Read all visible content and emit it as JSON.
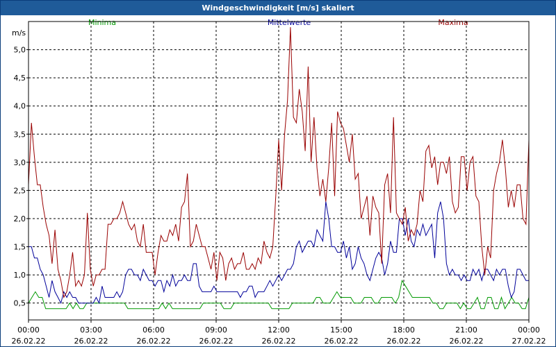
{
  "window": {
    "title": "Windgeschwindigkeit [m/s] skaliert"
  },
  "colors": {
    "minima": "#009900",
    "mittelwerte": "#000099",
    "maxima": "#990000",
    "title_bar": "#1f5b99",
    "grid": "#000000"
  },
  "chart_data": {
    "type": "line",
    "title": "Windgeschwindigkeit [m/s] skaliert",
    "ylabel": "m/s",
    "xlabel": "",
    "ylim": [
      0.2,
      5.5
    ],
    "y_ticks": [
      {
        "value": 0.5,
        "label": "0,5"
      },
      {
        "value": 1.0,
        "label": "1,0"
      },
      {
        "value": 1.5,
        "label": "1,5"
      },
      {
        "value": 2.0,
        "label": "2,0"
      },
      {
        "value": 2.5,
        "label": "2,5"
      },
      {
        "value": 3.0,
        "label": "3,0"
      },
      {
        "value": 3.5,
        "label": "3,5"
      },
      {
        "value": 4.0,
        "label": "4,0"
      },
      {
        "value": 4.5,
        "label": "4,5"
      },
      {
        "value": 5.0,
        "label": "5,0"
      }
    ],
    "x_range": [
      "26.02.22 00:00",
      "27.02.22 00:00"
    ],
    "x_ticks": [
      {
        "time": "00:00",
        "date": "26.02.22"
      },
      {
        "time": "03:00",
        "date": "26.02.22"
      },
      {
        "time": "06:00",
        "date": "26.02.22"
      },
      {
        "time": "09:00",
        "date": "26.02.22"
      },
      {
        "time": "12:00",
        "date": "26.02.22"
      },
      {
        "time": "15:00",
        "date": "26.02.22"
      },
      {
        "time": "18:00",
        "date": "26.02.22"
      },
      {
        "time": "21:00",
        "date": "26.02.22"
      },
      {
        "time": "00:00",
        "date": "27.02.22"
      }
    ],
    "grid": true,
    "legend_position": "top",
    "x": [
      "00:00",
      "00:10",
      "00:20",
      "00:30",
      "00:40",
      "00:50",
      "01:00",
      "01:10",
      "01:20",
      "01:30",
      "01:40",
      "01:50",
      "02:00",
      "02:10",
      "02:20",
      "02:30",
      "02:40",
      "02:50",
      "03:00",
      "03:10",
      "03:20",
      "03:30",
      "03:40",
      "03:50",
      "04:00",
      "04:10",
      "04:20",
      "04:30",
      "04:40",
      "04:50",
      "05:00",
      "05:10",
      "05:20",
      "05:30",
      "05:40",
      "05:50",
      "06:00",
      "06:10",
      "06:20",
      "06:30",
      "06:40",
      "06:50",
      "07:00",
      "07:10",
      "07:20",
      "07:30",
      "07:40",
      "07:50",
      "08:00",
      "08:10",
      "08:20",
      "08:30",
      "08:40",
      "08:50",
      "09:00",
      "09:10",
      "09:20",
      "09:30",
      "09:40",
      "09:50",
      "10:00",
      "10:10",
      "10:20",
      "10:30",
      "10:40",
      "10:50",
      "11:00",
      "11:10",
      "11:20",
      "11:30",
      "11:40",
      "11:50",
      "12:00",
      "12:10",
      "12:20",
      "12:30",
      "12:40",
      "12:50",
      "13:00",
      "13:10",
      "13:20",
      "13:30",
      "13:40",
      "13:50",
      "14:00",
      "14:10",
      "14:20",
      "14:30",
      "14:40",
      "14:50",
      "15:00",
      "15:10",
      "15:20",
      "15:30",
      "15:40",
      "15:50",
      "16:00",
      "16:10",
      "16:20",
      "16:30",
      "16:40",
      "16:50",
      "17:00",
      "17:10",
      "17:20",
      "17:30",
      "17:40",
      "17:50",
      "18:00",
      "18:10",
      "18:20",
      "18:30",
      "18:40",
      "18:50",
      "19:00",
      "19:10",
      "19:20",
      "19:30",
      "19:40",
      "19:50",
      "20:00",
      "20:10",
      "20:20",
      "20:30",
      "20:40",
      "20:50",
      "21:00",
      "21:10",
      "21:20",
      "21:30",
      "21:40",
      "21:50",
      "22:00",
      "22:10",
      "22:20",
      "22:30",
      "22:40",
      "22:50",
      "23:00",
      "23:10",
      "23:20",
      "23:30",
      "23:40",
      "23:50",
      "00:00"
    ],
    "series": [
      {
        "name": "Minima",
        "color": "#009900",
        "values": [
          0.5,
          0.6,
          0.7,
          0.6,
          0.6,
          0.4,
          0.4,
          0.4,
          0.4,
          0.4,
          0.4,
          0.4,
          0.5,
          0.4,
          0.5,
          0.4,
          0.4,
          0.5,
          0.5,
          0.5,
          0.5,
          0.5,
          0.5,
          0.5,
          0.5,
          0.5,
          0.5,
          0.5,
          0.5,
          0.4,
          0.4,
          0.4,
          0.4,
          0.4,
          0.4,
          0.4,
          0.4,
          0.4,
          0.4,
          0.5,
          0.4,
          0.5,
          0.4,
          0.4,
          0.4,
          0.4,
          0.4,
          0.4,
          0.4,
          0.4,
          0.4,
          0.5,
          0.5,
          0.5,
          0.5,
          0.5,
          0.5,
          0.4,
          0.4,
          0.4,
          0.5,
          0.5,
          0.5,
          0.5,
          0.5,
          0.5,
          0.5,
          0.5,
          0.5,
          0.5,
          0.5,
          0.4,
          0.4,
          0.4,
          0.4,
          0.4,
          0.4,
          0.5,
          0.5,
          0.5,
          0.5,
          0.5,
          0.5,
          0.5,
          0.6,
          0.6,
          0.5,
          0.5,
          0.5,
          0.6,
          0.7,
          0.6,
          0.6,
          0.6,
          0.6,
          0.5,
          0.5,
          0.5,
          0.6,
          0.6,
          0.6,
          0.5,
          0.5,
          0.6,
          0.6,
          0.6,
          0.6,
          0.5,
          0.6,
          0.9,
          0.8,
          0.7,
          0.6,
          0.6,
          0.6,
          0.6,
          0.6,
          0.6,
          0.5,
          0.5,
          0.4,
          0.4,
          0.5,
          0.5,
          0.5,
          0.5,
          0.4,
          0.5,
          0.4,
          0.4,
          0.5,
          0.6,
          0.4,
          0.4,
          0.6,
          0.6,
          0.4,
          0.4,
          0.6,
          0.4,
          0.5,
          0.6,
          0.5,
          0.5,
          0.4,
          0.4,
          0.6
        ]
      },
      {
        "name": "Mittelwerte",
        "color": "#000099",
        "values": [
          1.5,
          1.5,
          1.3,
          1.3,
          1.1,
          1.0,
          0.8,
          0.6,
          0.9,
          0.7,
          0.6,
          0.5,
          0.7,
          0.6,
          0.7,
          0.6,
          0.6,
          0.5,
          0.5,
          0.5,
          0.5,
          0.5,
          0.5,
          0.6,
          0.5,
          0.8,
          0.6,
          0.6,
          0.6,
          0.6,
          0.7,
          0.6,
          0.7,
          1.0,
          1.1,
          1.1,
          1.0,
          1.0,
          0.9,
          1.1,
          1.0,
          0.9,
          0.9,
          0.8,
          0.9,
          0.9,
          0.7,
          0.9,
          0.8,
          1.0,
          0.8,
          0.9,
          0.9,
          1.0,
          0.9,
          0.9,
          1.2,
          1.2,
          0.8,
          0.7,
          0.7,
          0.7,
          0.7,
          0.8,
          0.7,
          0.7,
          0.7,
          0.7,
          0.7,
          0.7,
          0.7,
          0.7,
          0.6,
          0.7,
          0.7,
          0.8,
          0.8,
          0.6,
          0.7,
          0.7,
          0.7,
          0.8,
          0.9,
          0.8,
          0.9,
          1.0,
          0.9,
          1.0,
          1.1,
          1.1,
          1.2,
          1.5,
          1.6,
          1.4,
          1.5,
          1.6,
          1.6,
          1.5,
          1.8,
          1.7,
          1.6,
          2.3,
          2.0,
          1.5,
          1.5,
          1.4,
          1.4,
          1.6,
          1.3,
          1.5,
          1.1,
          1.2,
          1.5,
          1.3,
          1.2,
          1.0,
          0.9,
          1.1,
          1.3,
          1.4,
          1.3,
          1.0,
          1.2,
          1.6,
          1.4,
          1.4,
          2.0,
          2.0,
          1.7,
          2.0,
          1.6,
          1.5,
          1.8,
          1.7,
          1.9,
          1.7,
          1.8,
          1.9,
          1.3,
          2.1,
          2.3,
          2.0,
          1.2,
          1.0,
          1.1,
          1.0,
          1.0,
          0.9,
          1.0,
          0.9,
          0.9,
          1.1,
          1.0,
          1.1,
          0.9,
          1.1,
          1.1,
          1.0,
          0.9,
          1.1,
          1.0,
          1.1,
          1.1,
          0.8,
          0.6,
          0.7,
          1.1,
          1.1,
          1.0,
          0.9,
          0.9
        ]
      },
      {
        "name": "Maxima",
        "color": "#990000",
        "values": [
          2.6,
          3.7,
          3.1,
          2.6,
          2.6,
          2.2,
          1.9,
          1.7,
          1.2,
          1.8,
          1.1,
          0.9,
          0.6,
          0.7,
          1.0,
          1.4,
          0.8,
          0.9,
          0.8,
          1.0,
          2.1,
          1.1,
          0.8,
          1.0,
          1.0,
          1.1,
          1.1,
          1.9,
          1.9,
          2.0,
          2.0,
          2.1,
          2.3,
          2.1,
          1.9,
          1.8,
          1.9,
          1.6,
          1.5,
          1.9,
          1.4,
          1.4,
          1.4,
          1.0,
          1.4,
          1.7,
          1.6,
          1.6,
          1.8,
          1.7,
          1.9,
          1.6,
          2.2,
          2.3,
          2.8,
          1.5,
          1.6,
          1.9,
          1.7,
          1.5,
          1.5,
          1.3,
          1.1,
          1.4,
          0.9,
          1.4,
          1.3,
          0.9,
          1.2,
          1.3,
          1.1,
          1.2,
          1.2,
          1.4,
          1.1,
          1.1,
          1.2,
          1.1,
          1.3,
          1.2,
          1.6,
          1.4,
          1.3,
          1.5,
          2.4,
          3.4,
          2.5,
          3.5,
          4.1,
          5.4,
          3.8,
          3.7,
          4.3,
          3.9,
          3.2,
          4.7,
          3.0,
          3.8,
          2.9,
          2.4,
          2.7,
          2.3,
          2.9,
          3.7,
          2.4,
          3.9,
          3.7,
          3.6,
          3.3,
          3.0,
          3.5,
          2.7,
          2.8,
          2.0,
          2.2,
          2.4,
          1.7,
          2.4,
          2.2,
          2.1,
          1.2,
          2.6,
          2.8,
          2.1,
          3.8,
          2.1,
          2.0,
          1.9,
          2.2,
          1.6,
          1.8,
          1.7,
          1.9,
          2.5,
          2.3,
          3.2,
          3.3,
          2.9,
          3.1,
          2.6,
          3.0,
          3.0,
          2.8,
          3.1,
          2.3,
          2.1,
          2.2,
          3.1,
          3.1,
          2.5,
          3.0,
          3.1,
          2.4,
          2.3,
          1.5,
          1.0,
          1.5,
          1.3,
          2.5,
          2.8,
          3.0,
          3.4,
          2.9,
          2.2,
          2.5,
          2.2,
          2.6,
          2.6,
          2.0,
          1.9,
          3.4
        ]
      }
    ]
  }
}
